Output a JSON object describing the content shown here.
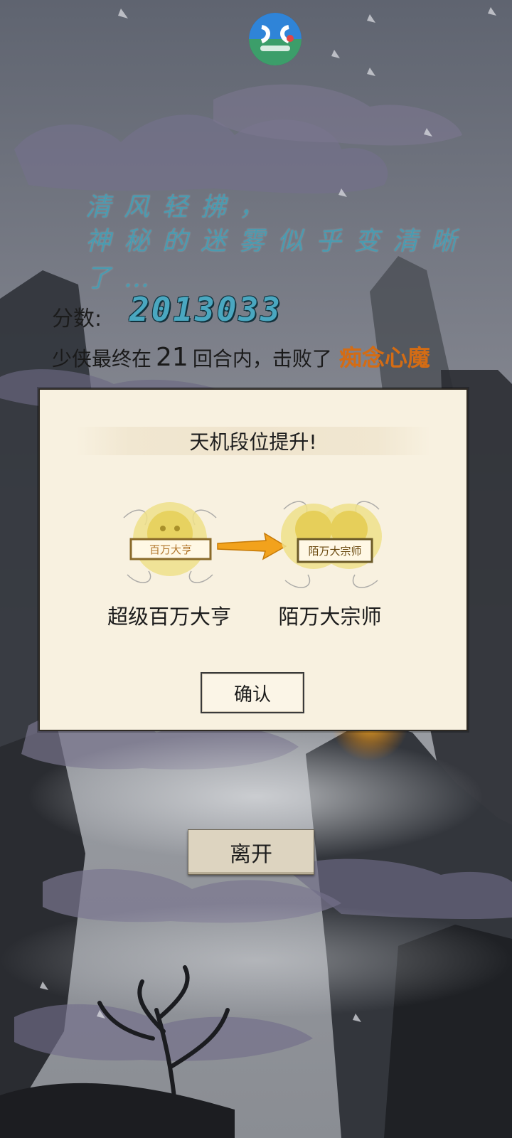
{
  "poem": {
    "line1": "清风轻拂，",
    "line2": "神秘的迷雾似乎变清晰了…"
  },
  "score": {
    "label": "分数:",
    "value": "2013033"
  },
  "result": {
    "prefix": "少侠最终在",
    "rounds": "21",
    "middle": "回合内，击败了",
    "boss": "痴念心魔"
  },
  "modal": {
    "title": "天机段位提升!",
    "old_rank": "超级百万大亨",
    "old_badge_text": "百万大亨",
    "new_rank": "陌万大宗师",
    "new_badge_text": "陌万大宗师",
    "confirm_label": "确认"
  },
  "leave_label": "离开",
  "colors": {
    "score": "#4aa7c0",
    "poem": "#4a9bb0",
    "boss": "#d46c14",
    "arrow": "#f2a21c"
  }
}
